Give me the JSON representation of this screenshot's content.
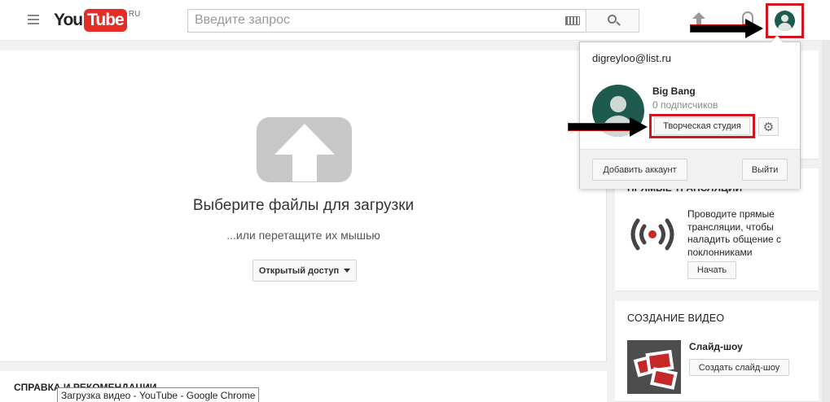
{
  "header": {
    "logo_you": "You",
    "logo_tube": "Tube",
    "logo_region": "RU",
    "search_placeholder": "Введите запрос",
    "icons": [
      "menu-icon",
      "keyboard-icon",
      "search-icon",
      "upload-icon",
      "bell-icon",
      "avatar-icon"
    ]
  },
  "upload": {
    "title": "Выберите файлы для загрузки",
    "subtitle": "...или перетащите их мышью",
    "privacy_label": "Открытый доступ"
  },
  "help": {
    "title": "СПРАВКА И РЕКОМЕНДАЦИИ"
  },
  "account_menu": {
    "email": "digreyloo@list.ru",
    "channel_name": "Big Bang",
    "subscribers": "0 подписчиков",
    "studio_label": "Творческая студия",
    "add_account_label": "Добавить аккаунт",
    "logout_label": "Выйти"
  },
  "live": {
    "title": "ПРЯМЫЕ ТРАНСЛЯЦИИ",
    "description": "Проводите прямые трансляции, чтобы наладить общение с поклонниками",
    "start_label": "Начать"
  },
  "create": {
    "title": "СОЗДАНИЕ ВИДЕО",
    "slideshow_label": "Слайд-шоу",
    "slideshow_button": "Создать слайд-шоу"
  },
  "tooltip": {
    "text": "Загрузка видео - YouTube - Google Chrome"
  },
  "colors": {
    "accent_red": "#e52d27",
    "highlight_red": "#d0151f",
    "avatar_green": "#1f5a4f"
  }
}
